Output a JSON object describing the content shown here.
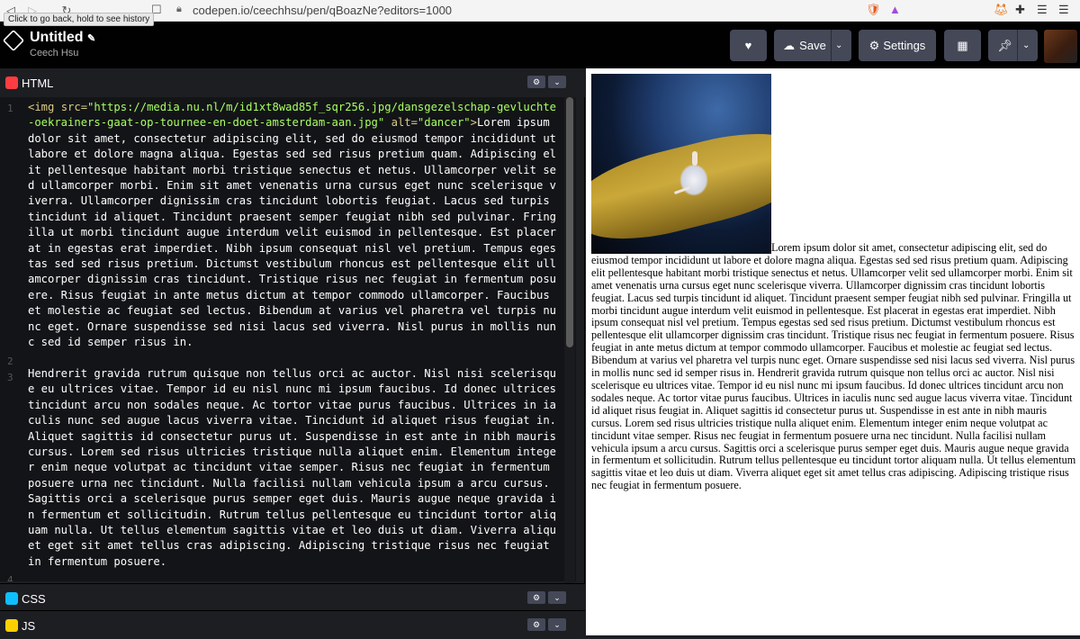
{
  "browser": {
    "tooltip": "Click to go back, hold to see history",
    "url": "codepen.io/ceechhsu/pen/qBoazNe?editors=1000"
  },
  "header": {
    "title": "Untitled",
    "author": "Ceech Hsu",
    "save_label": "Save",
    "settings_label": "Settings"
  },
  "panels": {
    "html_label": "HTML",
    "css_label": "CSS",
    "js_label": "JS"
  },
  "code": {
    "line1_tag_open": "<img ",
    "line1_attr_src": "src=",
    "line1_src_val": "\"https://media.nu.nl/m/id1xt8wad85f_sqr256.jpg/dansgezelschap-gevluchte-oekrainers-gaat-op-tournee-en-doet-amsterdam-aan.jpg\"",
    "line1_attr_alt": " alt=",
    "line1_alt_val": "\"dancer\"",
    "line1_tag_close": ">",
    "line1_text": "Lorem ipsum dolor sit amet, consectetur adipiscing elit, sed do eiusmod tempor incididunt ut labore et dolore magna aliqua. Egestas sed sed risus pretium quam. Adipiscing elit pellentesque habitant morbi tristique senectus et netus. Ullamcorper velit sed ullamcorper morbi. Enim sit amet venenatis urna cursus eget nunc scelerisque viverra. Ullamcorper dignissim cras tincidunt lobortis feugiat. Lacus sed turpis tincidunt id aliquet. Tincidunt praesent semper feugiat nibh sed pulvinar. Fringilla ut morbi tincidunt augue interdum velit euismod in pellentesque. Est placerat in egestas erat imperdiet. Nibh ipsum consequat nisl vel pretium. Tempus egestas sed sed risus pretium. Dictumst vestibulum rhoncus est pellentesque elit ullamcorper dignissim cras tincidunt. Tristique risus nec feugiat in fermentum posuere. Risus feugiat in ante metus dictum at tempor commodo ullamcorper. Faucibus et molestie ac feugiat sed lectus. Bibendum at varius vel pharetra vel turpis nunc eget. Ornare suspendisse sed nisi lacus sed viverra. Nisl purus in mollis nunc sed id semper risus in.",
    "line3_text": "Hendrerit gravida rutrum quisque non tellus orci ac auctor. Nisl nisi scelerisque eu ultrices vitae. Tempor id eu nisl nunc mi ipsum faucibus. Id donec ultrices tincidunt arcu non sodales neque. Ac tortor vitae purus faucibus. Ultrices in iaculis nunc sed augue lacus viverra vitae. Tincidunt id aliquet risus feugiat in. Aliquet sagittis id consectetur purus ut. Suspendisse in est ante in nibh mauris cursus. Lorem sed risus ultricies tristique nulla aliquet enim. Elementum integer enim neque volutpat ac tincidunt vitae semper. Risus nec feugiat in fermentum posuere urna nec tincidunt. Nulla facilisi nullam vehicula ipsum a arcu cursus. Sagittis orci a scelerisque purus semper eget duis. Mauris augue neque gravida in fermentum et sollicitudin. Rutrum tellus pellentesque eu tincidunt tortor aliquam nulla. Ut tellus elementum sagittis vitae et leo duis ut diam. Viverra aliquet eget sit amet tellus cras adipiscing. Adipiscing tristique risus nec feugiat in fermentum posuere.",
    "line_numbers": [
      "1",
      "2",
      "3",
      "4"
    ]
  },
  "preview": {
    "text": "Lorem ipsum dolor sit amet, consectetur adipiscing elit, sed do eiusmod tempor incididunt ut labore et dolore magna aliqua. Egestas sed sed risus pretium quam. Adipiscing elit pellentesque habitant morbi tristique senectus et netus. Ullamcorper velit sed ullamcorper morbi. Enim sit amet venenatis urna cursus eget nunc scelerisque viverra. Ullamcorper dignissim cras tincidunt lobortis feugiat. Lacus sed turpis tincidunt id aliquet. Tincidunt praesent semper feugiat nibh sed pulvinar. Fringilla ut morbi tincidunt augue interdum velit euismod in pellentesque. Est placerat in egestas erat imperdiet. Nibh ipsum consequat nisl vel pretium. Tempus egestas sed sed risus pretium. Dictumst vestibulum rhoncus est pellentesque elit ullamcorper dignissim cras tincidunt. Tristique risus nec feugiat in fermentum posuere. Risus feugiat in ante metus dictum at tempor commodo ullamcorper. Faucibus et molestie ac feugiat sed lectus. Bibendum at varius vel pharetra vel turpis nunc eget. Ornare suspendisse sed nisi lacus sed viverra. Nisl purus in mollis nunc sed id semper risus in. Hendrerit gravida rutrum quisque non tellus orci ac auctor. Nisl nisi scelerisque eu ultrices vitae. Tempor id eu nisl nunc mi ipsum faucibus. Id donec ultrices tincidunt arcu non sodales neque. Ac tortor vitae purus faucibus. Ultrices in iaculis nunc sed augue lacus viverra vitae. Tincidunt id aliquet risus feugiat in. Aliquet sagittis id consectetur purus ut. Suspendisse in est ante in nibh mauris cursus. Lorem sed risus ultricies tristique nulla aliquet enim. Elementum integer enim neque volutpat ac tincidunt vitae semper. Risus nec feugiat in fermentum posuere urna nec tincidunt. Nulla facilisi nullam vehicula ipsum a arcu cursus. Sagittis orci a scelerisque purus semper eget duis. Mauris augue neque gravida in fermentum et sollicitudin. Rutrum tellus pellentesque eu tincidunt tortor aliquam nulla. Ut tellus elementum sagittis vitae et leo duis ut diam. Viverra aliquet eget sit amet tellus cras adipiscing. Adipiscing tristique risus nec feugiat in fermentum posuere."
  },
  "colors": {
    "html_icon": "#ff3c41",
    "css_icon": "#0ebeff",
    "js_icon": "#fcd000",
    "string": "#a8ff60",
    "tag": "#dccb86"
  }
}
